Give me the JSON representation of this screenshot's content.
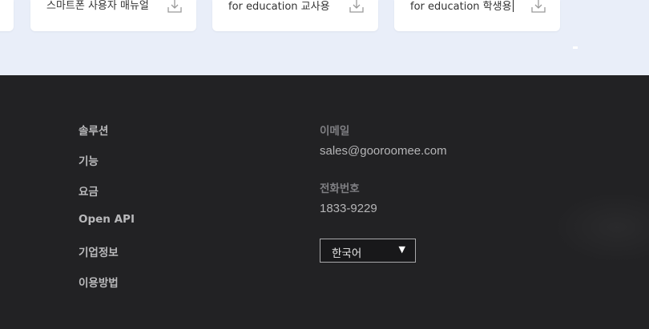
{
  "downloads": {
    "cards": [
      {
        "label": "스마트폰 사용자 매뉴얼",
        "icon": "download-icon"
      },
      {
        "label": "for education 교사용",
        "icon": "download-icon"
      },
      {
        "label": "for education 학생용",
        "icon": "download-icon"
      }
    ]
  },
  "footer": {
    "nav": [
      "솔루션",
      "기능",
      "요금",
      "Open API",
      "기업정보",
      "이용방법"
    ],
    "contact": {
      "email_label": "이메일",
      "email_value": "sales@gooroomee.com",
      "phone_label": "전화번호",
      "phone_value": "1833-9229"
    },
    "language": {
      "selected": "한국어",
      "arrow": "▼"
    }
  },
  "colors": {
    "top_background": "#e9eef9",
    "footer_background": "#222224",
    "card_background": "#ffffff"
  }
}
